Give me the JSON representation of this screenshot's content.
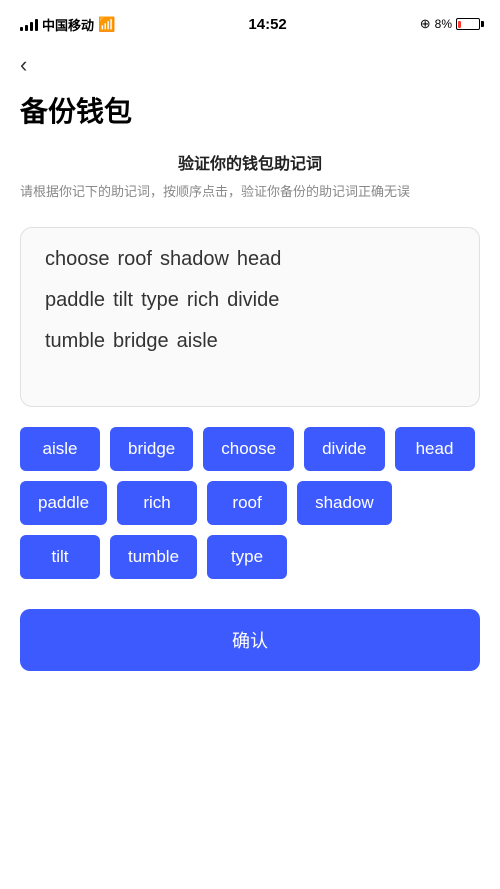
{
  "statusBar": {
    "carrier": "中国移动",
    "time": "14:52",
    "battery": "8%"
  },
  "back": {
    "label": "‹"
  },
  "page": {
    "title": "备份钱包",
    "subtitle": "验证你的钱包助记词",
    "description": "请根据你记下的助记词，按顺序点击，验证你备份的助记词正确无误"
  },
  "wordPoolRows": [
    [
      "choose",
      "roof",
      "shadow",
      "head"
    ],
    [
      "paddle",
      "tilt",
      "type",
      "rich",
      "divide"
    ],
    [
      "tumble",
      "bridge",
      "aisle"
    ]
  ],
  "selectableWords": [
    "aisle",
    "bridge",
    "choose",
    "divide",
    "head",
    "paddle",
    "rich",
    "roof",
    "shadow",
    "tilt",
    "tumble",
    "type"
  ],
  "confirmButton": {
    "label": "确认"
  }
}
